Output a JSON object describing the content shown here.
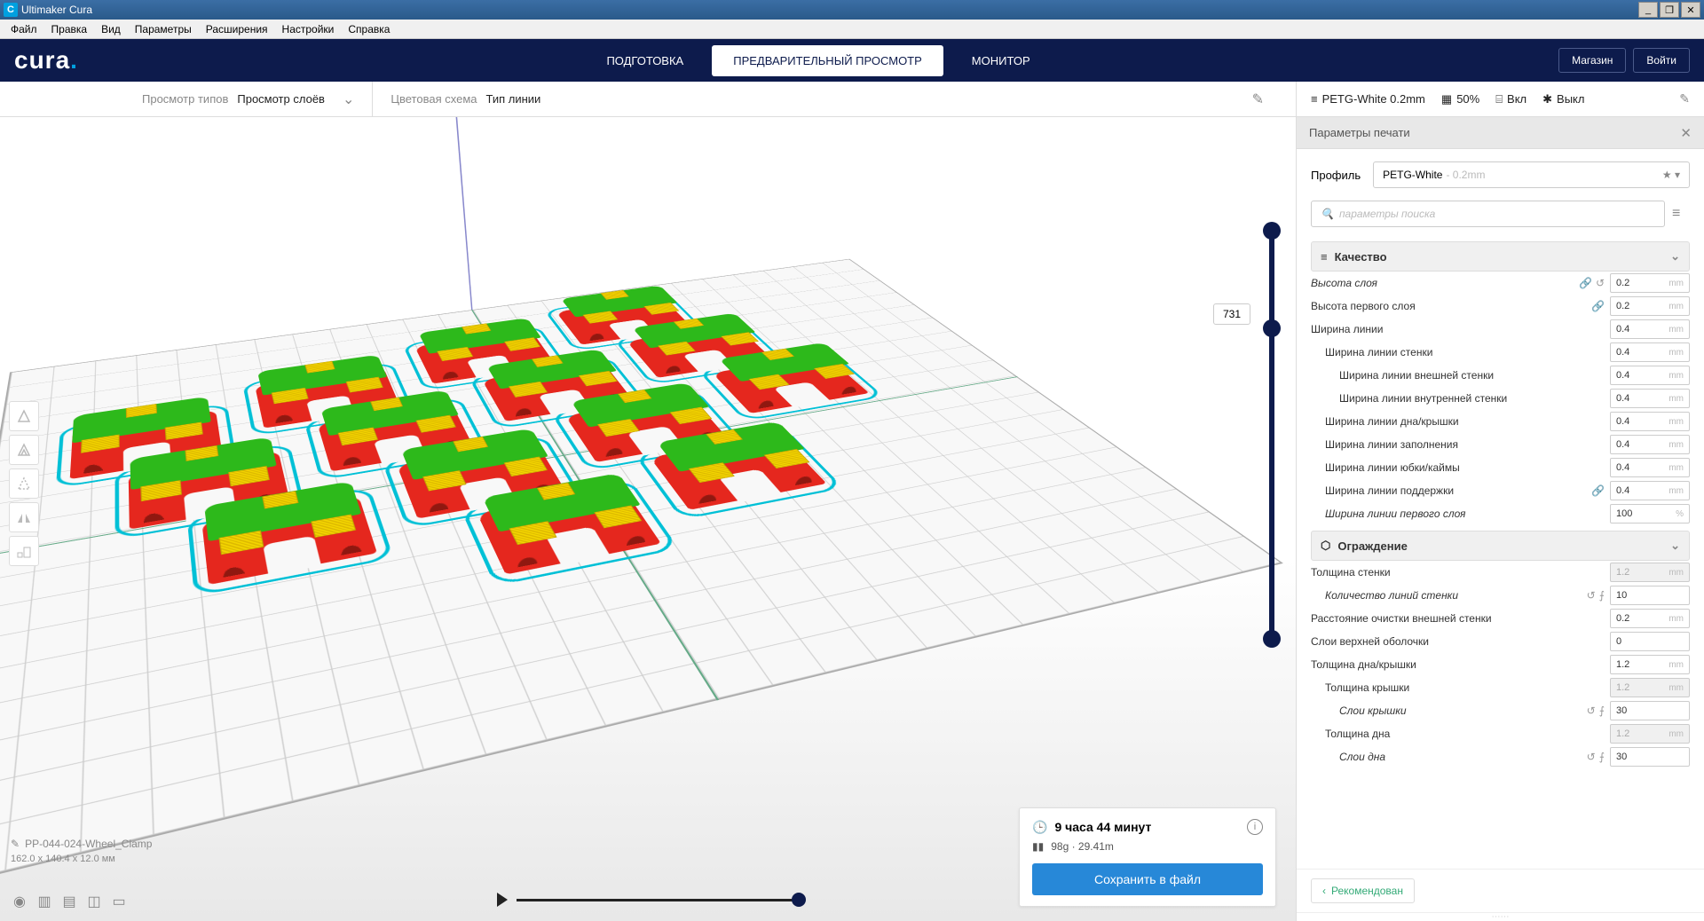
{
  "titlebar": {
    "app": "Ultimaker Cura"
  },
  "menu": {
    "items": [
      "Файл",
      "Правка",
      "Вид",
      "Параметры",
      "Расширения",
      "Настройки",
      "Справка"
    ]
  },
  "header": {
    "logo": "cura",
    "tabs": {
      "prepare": "ПОДГОТОВКА",
      "preview": "ПРЕДВАРИТЕЛЬНЫЙ ПРОСМОТР",
      "monitor": "МОНИТОР"
    },
    "market": "Магазин",
    "login": "Войти"
  },
  "toolbar": {
    "viewtype_label": "Просмотр типов",
    "viewtype_value": "Просмотр слоёв",
    "colorscheme_label": "Цветовая схема",
    "colorscheme_value": "Тип линии",
    "profile": "PETG-White 0.2mm",
    "infill": "50%",
    "support": "Вкл",
    "adhesion": "Выкл"
  },
  "panel": {
    "title": "Параметры печати",
    "profile_label": "Профиль",
    "profile_value": "PETG-White",
    "profile_hint": "- 0.2mm",
    "search_placeholder": "параметры поиска",
    "sections": {
      "quality": "Качество",
      "shell": "Ограждение"
    },
    "settings": {
      "layer_height": {
        "label": "Высота слоя",
        "value": "0.2",
        "unit": "mm",
        "indent": 0,
        "ital": true,
        "icons": [
          "link",
          "reset"
        ]
      },
      "initial_layer_height": {
        "label": "Высота первого слоя",
        "value": "0.2",
        "unit": "mm",
        "indent": 0,
        "icons": [
          "link"
        ]
      },
      "line_width": {
        "label": "Ширина линии",
        "value": "0.4",
        "unit": "mm",
        "indent": 0
      },
      "wall_line_width": {
        "label": "Ширина линии стенки",
        "value": "0.4",
        "unit": "mm",
        "indent": 1
      },
      "outer_wall_line_width": {
        "label": "Ширина линии внешней стенки",
        "value": "0.4",
        "unit": "mm",
        "indent": 2
      },
      "inner_wall_line_width": {
        "label": "Ширина линии внутренней стенки",
        "value": "0.4",
        "unit": "mm",
        "indent": 2
      },
      "topbottom_line_width": {
        "label": "Ширина линии дна/крышки",
        "value": "0.4",
        "unit": "mm",
        "indent": 1
      },
      "infill_line_width": {
        "label": "Ширина линии заполнения",
        "value": "0.4",
        "unit": "mm",
        "indent": 1
      },
      "skirt_line_width": {
        "label": "Ширина линии юбки/каймы",
        "value": "0.4",
        "unit": "mm",
        "indent": 1
      },
      "support_line_width": {
        "label": "Ширина линии поддержки",
        "value": "0.4",
        "unit": "mm",
        "indent": 1,
        "icons": [
          "link"
        ]
      },
      "initial_layer_line_width": {
        "label": "Ширина линии первого слоя",
        "value": "100",
        "unit": "%",
        "indent": 1,
        "ital": true
      },
      "wall_thickness": {
        "label": "Толщина стенки",
        "value": "1.2",
        "unit": "mm",
        "indent": 0,
        "disabled": true
      },
      "wall_line_count": {
        "label": "Количество линий стенки",
        "value": "10",
        "unit": "",
        "indent": 1,
        "ital": true,
        "icons": [
          "reset",
          "fx"
        ]
      },
      "outer_wall_wipe": {
        "label": "Расстояние очистки внешней стенки",
        "value": "0.2",
        "unit": "mm",
        "indent": 0
      },
      "top_layers_shell": {
        "label": "Слои верхней оболочки",
        "value": "0",
        "unit": "",
        "indent": 0
      },
      "topbottom_thickness": {
        "label": "Толщина дна/крышки",
        "value": "1.2",
        "unit": "mm",
        "indent": 0
      },
      "top_thickness": {
        "label": "Толщина крышки",
        "value": "1.2",
        "unit": "mm",
        "indent": 1,
        "disabled": true
      },
      "top_layers": {
        "label": "Слои крышки",
        "value": "30",
        "unit": "",
        "indent": 2,
        "ital": true,
        "icons": [
          "reset",
          "fx"
        ]
      },
      "bottom_thickness": {
        "label": "Толщина дна",
        "value": "1.2",
        "unit": "mm",
        "indent": 1,
        "disabled": true
      },
      "bottom_layers": {
        "label": "Слои дна",
        "value": "30",
        "unit": "",
        "indent": 2,
        "ital": true,
        "icons": [
          "reset",
          "fx"
        ]
      }
    },
    "recommended": "Рекомендован"
  },
  "file": {
    "name": "PP-044-024-Wheel_Clamp",
    "dims": "162.0 x 140.4 x 12.0 мм"
  },
  "layer_badge": "731",
  "print": {
    "time": "9 часа 44 минут",
    "material": "98g · 29.41m",
    "save": "Сохранить в файл"
  }
}
